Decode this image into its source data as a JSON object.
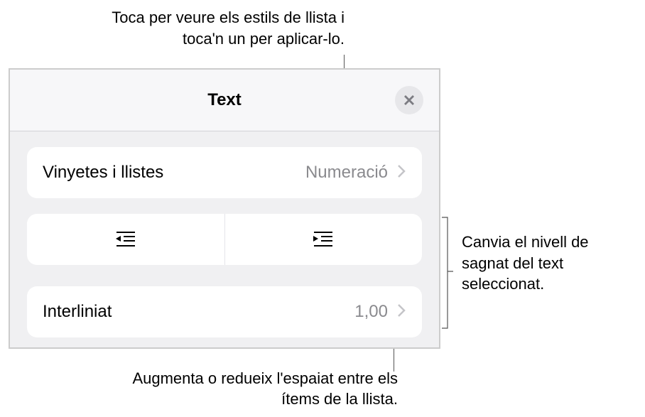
{
  "callouts": {
    "top": "Toca per veure els estils de llista i toca'n un per aplicar-lo.",
    "right": "Canvia el nivell de sagnat del text seleccionat.",
    "bottom": "Augmenta o redueix l'espaiat entre els ítems de la llista."
  },
  "panel": {
    "title": "Text",
    "bullets": {
      "label": "Vinyetes i llistes",
      "value": "Numeració"
    },
    "linespacing": {
      "label": "Interliniat",
      "value": "1,00"
    }
  }
}
